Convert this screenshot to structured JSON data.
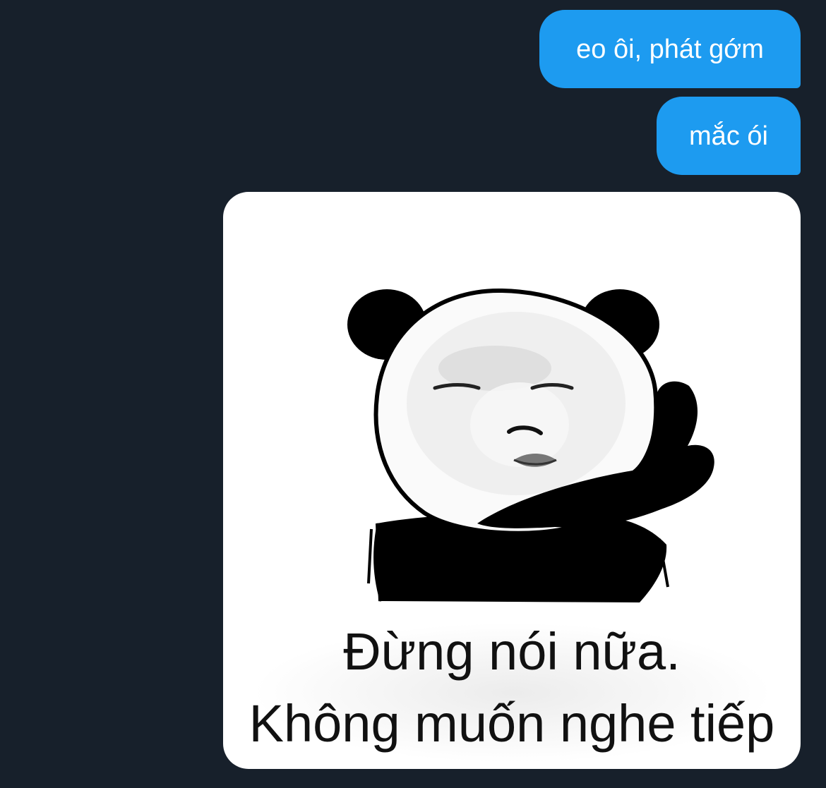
{
  "messages": [
    {
      "text": "eo ôi, phát gớm"
    },
    {
      "text": "mắc ói"
    }
  ],
  "sticker": {
    "caption_line1": "Đừng nói nữa.",
    "caption_line2": "Không muốn nghe tiếp"
  },
  "colors": {
    "background": "#17202b",
    "bubble": "#1d9bf0",
    "bubble_text": "#ffffff"
  }
}
